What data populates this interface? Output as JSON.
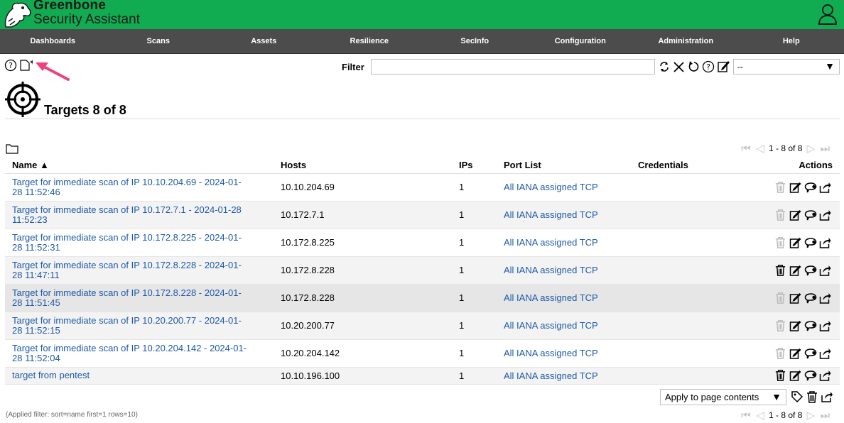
{
  "brand": {
    "line1": "Greenbone",
    "line2": "Security Assistant"
  },
  "menu": [
    "Dashboards",
    "Scans",
    "Assets",
    "Resilience",
    "SecInfo",
    "Configuration",
    "Administration",
    "Help"
  ],
  "toolbar": {
    "filter_label": "Filter",
    "filter_value": "",
    "filter_select": "--"
  },
  "page": {
    "title": "Targets 8 of 8"
  },
  "pagination": {
    "top": "1 - 8 of 8",
    "bottom": "1 - 8 of 8"
  },
  "table": {
    "columns": [
      "Name ▲",
      "Hosts",
      "IPs",
      "Port List",
      "Credentials",
      "Actions"
    ],
    "rows": [
      {
        "name_l1": "Target for immediate scan of IP 10.10.204.69 - 2024-01-",
        "name_l2": "28 11:52:46",
        "hosts": "10.10.204.69",
        "ips": "1",
        "port_list": "All IANA assigned TCP",
        "credentials": "",
        "deletable": false
      },
      {
        "name_l1": "Target for immediate scan of IP 10.172.7.1 - 2024-01-28",
        "name_l2": "11:52:23",
        "hosts": "10.172.7.1",
        "ips": "1",
        "port_list": "All IANA assigned TCP",
        "credentials": "",
        "deletable": false
      },
      {
        "name_l1": "Target for immediate scan of IP 10.172.8.225 - 2024-01-",
        "name_l2": "28 11:52:31",
        "hosts": "10.172.8.225",
        "ips": "1",
        "port_list": "All IANA assigned TCP",
        "credentials": "",
        "deletable": false
      },
      {
        "name_l1": "Target for immediate scan of IP 10.172.8.228 - 2024-01-",
        "name_l2": "28 11:47:11",
        "hosts": "10.172.8.228",
        "ips": "1",
        "port_list": "All IANA assigned TCP",
        "credentials": "",
        "deletable": true
      },
      {
        "name_l1": "Target for immediate scan of IP 10.172.8.228 - 2024-01-",
        "name_l2": "28 11:51:45",
        "hosts": "10.172.8.228",
        "ips": "1",
        "port_list": "All IANA assigned TCP",
        "credentials": "",
        "deletable": false
      },
      {
        "name_l1": "Target for immediate scan of IP 10.20.200.77 - 2024-01-",
        "name_l2": "28 11:52:15",
        "hosts": "10.20.200.77",
        "ips": "1",
        "port_list": "All IANA assigned TCP",
        "credentials": "",
        "deletable": false
      },
      {
        "name_l1": "Target for immediate scan of IP 10.20.204.142 - 2024-01-",
        "name_l2": "28 11:52:04",
        "hosts": "10.20.204.142",
        "ips": "1",
        "port_list": "All IANA assigned TCP",
        "credentials": "",
        "deletable": false
      },
      {
        "name_l1": "target from pentest",
        "name_l2": "",
        "hosts": "10.10.196.100",
        "ips": "1",
        "port_list": "All IANA assigned TCP",
        "credentials": "",
        "deletable": true
      }
    ]
  },
  "bulk": {
    "apply_select": "Apply to page contents"
  },
  "footer": {
    "applied_filter": "(Applied filter: sort=name first=1 rows=10)"
  },
  "colors": {
    "brand_green": "#11ab51",
    "menu_bg": "#4c4c4c",
    "link": "#1e5aa8",
    "annotation_arrow": "#f0427a"
  },
  "icons": [
    "help-icon",
    "new-target-icon",
    "refresh-icon",
    "clear-icon",
    "reset-icon",
    "edit-filter-icon",
    "target-icon",
    "folder-icon",
    "trash-icon",
    "edit-icon",
    "clone-icon",
    "export-icon",
    "tag-icon",
    "user-icon"
  ]
}
